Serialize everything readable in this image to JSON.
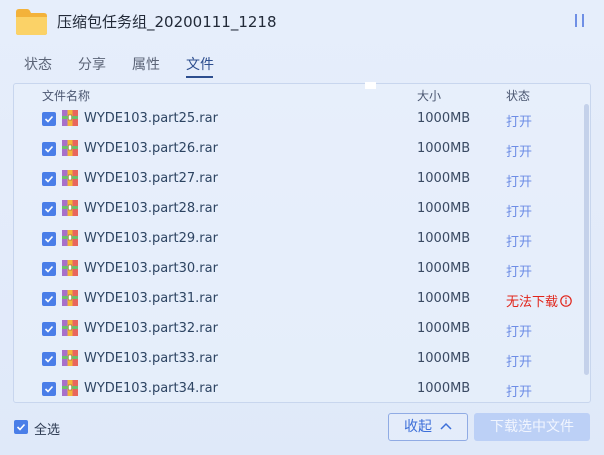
{
  "window": {
    "title": "压缩包任务组_20200111_1218"
  },
  "tabs": [
    {
      "label": "状态"
    },
    {
      "label": "分享"
    },
    {
      "label": "属性"
    },
    {
      "label": "文件"
    }
  ],
  "active_tab": "文件",
  "table": {
    "headers": {
      "name": "文件名称",
      "size": "大小",
      "status": "状态"
    },
    "rows": [
      {
        "name": "WYDE103.part25.rar",
        "size": "1000MB",
        "status": "打开",
        "checked": true
      },
      {
        "name": "WYDE103.part26.rar",
        "size": "1000MB",
        "status": "打开",
        "checked": true
      },
      {
        "name": "WYDE103.part27.rar",
        "size": "1000MB",
        "status": "打开",
        "checked": true
      },
      {
        "name": "WYDE103.part28.rar",
        "size": "1000MB",
        "status": "打开",
        "checked": true
      },
      {
        "name": "WYDE103.part29.rar",
        "size": "1000MB",
        "status": "打开",
        "checked": true
      },
      {
        "name": "WYDE103.part30.rar",
        "size": "1000MB",
        "status": "打开",
        "checked": true
      },
      {
        "name": "WYDE103.part31.rar",
        "size": "1000MB",
        "status": "无法下载",
        "checked": true,
        "error": true
      },
      {
        "name": "WYDE103.part32.rar",
        "size": "1000MB",
        "status": "打开",
        "checked": true
      },
      {
        "name": "WYDE103.part33.rar",
        "size": "1000MB",
        "status": "打开",
        "checked": true
      },
      {
        "name": "WYDE103.part34.rar",
        "size": "1000MB",
        "status": "打开",
        "checked": true
      }
    ]
  },
  "footer": {
    "select_all_label": "全选",
    "select_all_checked": true,
    "collapse_label": "收起",
    "download_label": "下载选中文件"
  },
  "colors": {
    "accent": "#4a7ee8",
    "link": "#6d8de6",
    "error": "#e1251b",
    "folder": "#f7c350"
  },
  "icons": {
    "folder": "folder-icon",
    "pause": "pause-icon",
    "file": "rar-archive-icon",
    "info": "info-icon",
    "chevron": "chevron-up-icon"
  }
}
